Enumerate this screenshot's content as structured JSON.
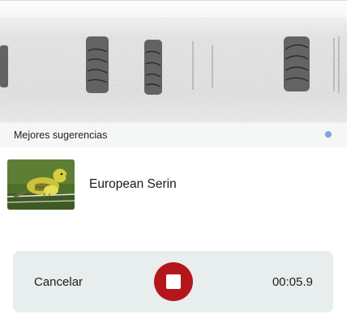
{
  "suggestions_header": {
    "title": "Mejores sugerencias"
  },
  "suggestions": [
    {
      "name": "European Serin"
    }
  ],
  "recorder": {
    "cancel_label": "Cancelar",
    "elapsed": "00:05.9"
  },
  "colors": {
    "stop_button": "#b5161c",
    "recorder_background": "#e8eeed",
    "live_indicator": "#7aa6d9"
  }
}
